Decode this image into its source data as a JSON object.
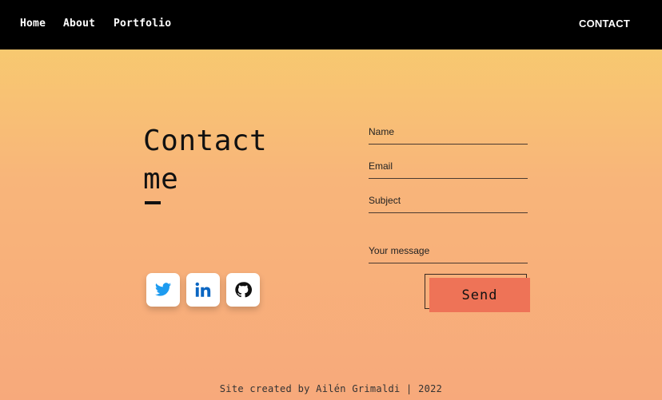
{
  "nav": {
    "home": "Home",
    "about": "About",
    "portfolio": "Portfolio",
    "contact": "CONTACT"
  },
  "contact": {
    "title": "Contact\nme"
  },
  "form": {
    "name_label": "Name",
    "email_label": "Email",
    "subject_label": "Subject",
    "message_label": "Your message",
    "send_label": "Send"
  },
  "social": {
    "icons": [
      "twitter-icon",
      "linkedin-icon",
      "github-icon"
    ]
  },
  "footer": {
    "prefix": "Site created by ",
    "author": "Ailén Grimaldi",
    "suffix": " | 2022"
  },
  "colors": {
    "navbar": "#000000",
    "send_button": "#ee7357",
    "twitter": "#1d9bf0",
    "linkedin": "#0a66c2",
    "github": "#111111"
  }
}
